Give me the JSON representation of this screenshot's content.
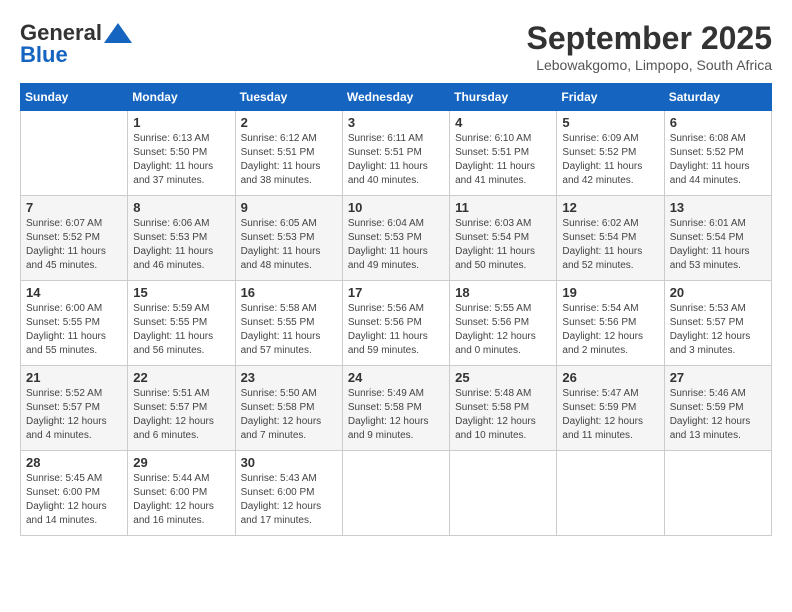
{
  "header": {
    "logo_general": "General",
    "logo_blue": "Blue",
    "month_title": "September 2025",
    "location": "Lebowakgomo, Limpopo, South Africa"
  },
  "weekdays": [
    "Sunday",
    "Monday",
    "Tuesday",
    "Wednesday",
    "Thursday",
    "Friday",
    "Saturday"
  ],
  "weeks": [
    [
      {
        "day": "",
        "info": ""
      },
      {
        "day": "1",
        "info": "Sunrise: 6:13 AM\nSunset: 5:50 PM\nDaylight: 11 hours\nand 37 minutes."
      },
      {
        "day": "2",
        "info": "Sunrise: 6:12 AM\nSunset: 5:51 PM\nDaylight: 11 hours\nand 38 minutes."
      },
      {
        "day": "3",
        "info": "Sunrise: 6:11 AM\nSunset: 5:51 PM\nDaylight: 11 hours\nand 40 minutes."
      },
      {
        "day": "4",
        "info": "Sunrise: 6:10 AM\nSunset: 5:51 PM\nDaylight: 11 hours\nand 41 minutes."
      },
      {
        "day": "5",
        "info": "Sunrise: 6:09 AM\nSunset: 5:52 PM\nDaylight: 11 hours\nand 42 minutes."
      },
      {
        "day": "6",
        "info": "Sunrise: 6:08 AM\nSunset: 5:52 PM\nDaylight: 11 hours\nand 44 minutes."
      }
    ],
    [
      {
        "day": "7",
        "info": "Sunrise: 6:07 AM\nSunset: 5:52 PM\nDaylight: 11 hours\nand 45 minutes."
      },
      {
        "day": "8",
        "info": "Sunrise: 6:06 AM\nSunset: 5:53 PM\nDaylight: 11 hours\nand 46 minutes."
      },
      {
        "day": "9",
        "info": "Sunrise: 6:05 AM\nSunset: 5:53 PM\nDaylight: 11 hours\nand 48 minutes."
      },
      {
        "day": "10",
        "info": "Sunrise: 6:04 AM\nSunset: 5:53 PM\nDaylight: 11 hours\nand 49 minutes."
      },
      {
        "day": "11",
        "info": "Sunrise: 6:03 AM\nSunset: 5:54 PM\nDaylight: 11 hours\nand 50 minutes."
      },
      {
        "day": "12",
        "info": "Sunrise: 6:02 AM\nSunset: 5:54 PM\nDaylight: 11 hours\nand 52 minutes."
      },
      {
        "day": "13",
        "info": "Sunrise: 6:01 AM\nSunset: 5:54 PM\nDaylight: 11 hours\nand 53 minutes."
      }
    ],
    [
      {
        "day": "14",
        "info": "Sunrise: 6:00 AM\nSunset: 5:55 PM\nDaylight: 11 hours\nand 55 minutes."
      },
      {
        "day": "15",
        "info": "Sunrise: 5:59 AM\nSunset: 5:55 PM\nDaylight: 11 hours\nand 56 minutes."
      },
      {
        "day": "16",
        "info": "Sunrise: 5:58 AM\nSunset: 5:55 PM\nDaylight: 11 hours\nand 57 minutes."
      },
      {
        "day": "17",
        "info": "Sunrise: 5:56 AM\nSunset: 5:56 PM\nDaylight: 11 hours\nand 59 minutes."
      },
      {
        "day": "18",
        "info": "Sunrise: 5:55 AM\nSunset: 5:56 PM\nDaylight: 12 hours\nand 0 minutes."
      },
      {
        "day": "19",
        "info": "Sunrise: 5:54 AM\nSunset: 5:56 PM\nDaylight: 12 hours\nand 2 minutes."
      },
      {
        "day": "20",
        "info": "Sunrise: 5:53 AM\nSunset: 5:57 PM\nDaylight: 12 hours\nand 3 minutes."
      }
    ],
    [
      {
        "day": "21",
        "info": "Sunrise: 5:52 AM\nSunset: 5:57 PM\nDaylight: 12 hours\nand 4 minutes."
      },
      {
        "day": "22",
        "info": "Sunrise: 5:51 AM\nSunset: 5:57 PM\nDaylight: 12 hours\nand 6 minutes."
      },
      {
        "day": "23",
        "info": "Sunrise: 5:50 AM\nSunset: 5:58 PM\nDaylight: 12 hours\nand 7 minutes."
      },
      {
        "day": "24",
        "info": "Sunrise: 5:49 AM\nSunset: 5:58 PM\nDaylight: 12 hours\nand 9 minutes."
      },
      {
        "day": "25",
        "info": "Sunrise: 5:48 AM\nSunset: 5:58 PM\nDaylight: 12 hours\nand 10 minutes."
      },
      {
        "day": "26",
        "info": "Sunrise: 5:47 AM\nSunset: 5:59 PM\nDaylight: 12 hours\nand 11 minutes."
      },
      {
        "day": "27",
        "info": "Sunrise: 5:46 AM\nSunset: 5:59 PM\nDaylight: 12 hours\nand 13 minutes."
      }
    ],
    [
      {
        "day": "28",
        "info": "Sunrise: 5:45 AM\nSunset: 6:00 PM\nDaylight: 12 hours\nand 14 minutes."
      },
      {
        "day": "29",
        "info": "Sunrise: 5:44 AM\nSunset: 6:00 PM\nDaylight: 12 hours\nand 16 minutes."
      },
      {
        "day": "30",
        "info": "Sunrise: 5:43 AM\nSunset: 6:00 PM\nDaylight: 12 hours\nand 17 minutes."
      },
      {
        "day": "",
        "info": ""
      },
      {
        "day": "",
        "info": ""
      },
      {
        "day": "",
        "info": ""
      },
      {
        "day": "",
        "info": ""
      }
    ]
  ]
}
